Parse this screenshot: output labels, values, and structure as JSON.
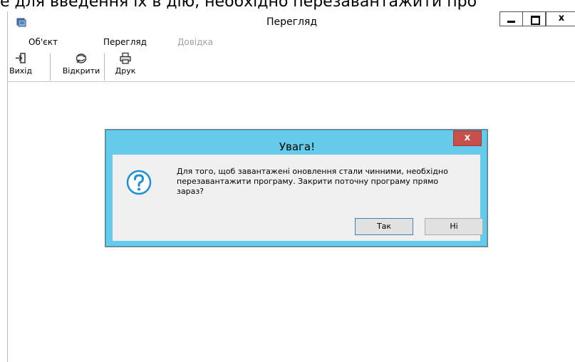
{
  "background": {
    "cropped_text": "е для введення їх в дію, необхідно перезавантажити про"
  },
  "window": {
    "title": "Перегляд",
    "controls": {
      "minimize_icon": "minimize-icon",
      "maximize_icon": "maximize-icon",
      "close_label": "x"
    }
  },
  "menu": {
    "items": [
      {
        "label": "Об'єкт",
        "enabled": true
      },
      {
        "label": "Перегляд",
        "enabled": true
      },
      {
        "label": "Довідка",
        "enabled": false
      }
    ]
  },
  "toolbar": {
    "buttons": [
      {
        "label": "Вихід",
        "icon": "exit-icon"
      },
      {
        "label": "Відкрити",
        "icon": "open-icon"
      },
      {
        "label": "Друк",
        "icon": "print-icon"
      }
    ]
  },
  "dialog": {
    "title": "Увага!",
    "close_label": "x",
    "icon": "question-icon",
    "message": "Для того, щоб завантажені оновлення стали чинними, необхідно\nперезавантажити програму. Закрити поточну програму прямо\nзараз?",
    "yes_label": "Так",
    "no_label": "Ні"
  },
  "colors": {
    "dialog_frame": "#66cbea",
    "dialog_close": "#c7504a",
    "question_icon": "#1e8fd6"
  }
}
